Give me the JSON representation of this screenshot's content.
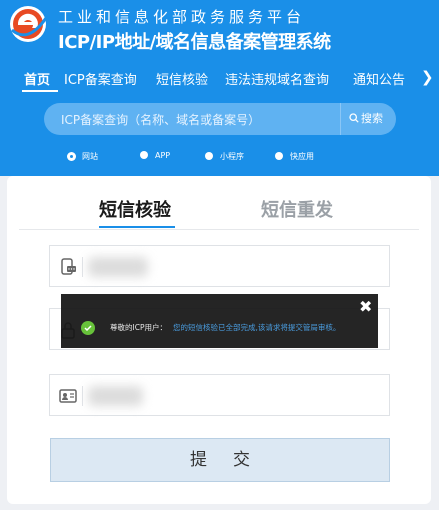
{
  "header": {
    "title_top": "工业和信息化部政务服务平台",
    "title_main": "ICP/IP地址/域名信息备案管理系统",
    "logo_icon": "gov-e-logo"
  },
  "nav": {
    "items": [
      {
        "label": "首页"
      },
      {
        "label": "ICP备案查询"
      },
      {
        "label": "短信核验"
      },
      {
        "label": "违法违规域名查询"
      },
      {
        "label": "通知公告"
      }
    ],
    "more_icon": "chevron-right-icon"
  },
  "search": {
    "placeholder": "ICP备案查询（名称、域名或备案号）",
    "button_label": "搜索"
  },
  "types": [
    {
      "label": "网站",
      "checked": true
    },
    {
      "label": "APP",
      "checked": false
    },
    {
      "label": "小程序",
      "checked": false
    },
    {
      "label": "快应用",
      "checked": false
    }
  ],
  "tabs": [
    {
      "label": "短信核验",
      "active": true
    },
    {
      "label": "短信重发",
      "active": false
    }
  ],
  "form": {
    "submit_label": "提交",
    "fields": [
      {
        "icon": "phone-message-icon"
      },
      {
        "icon": "lock-icon"
      },
      {
        "icon": "id-card-icon"
      }
    ]
  },
  "toast": {
    "label": "尊敬的ICP用户：",
    "message": "您的短信核验已全部完成,该请求将提交管局审核。",
    "close_symbol": "✖",
    "status_color": "#67c23a"
  },
  "colors": {
    "brand": "#1a8fe8",
    "accent_link": "#4a9de0"
  }
}
